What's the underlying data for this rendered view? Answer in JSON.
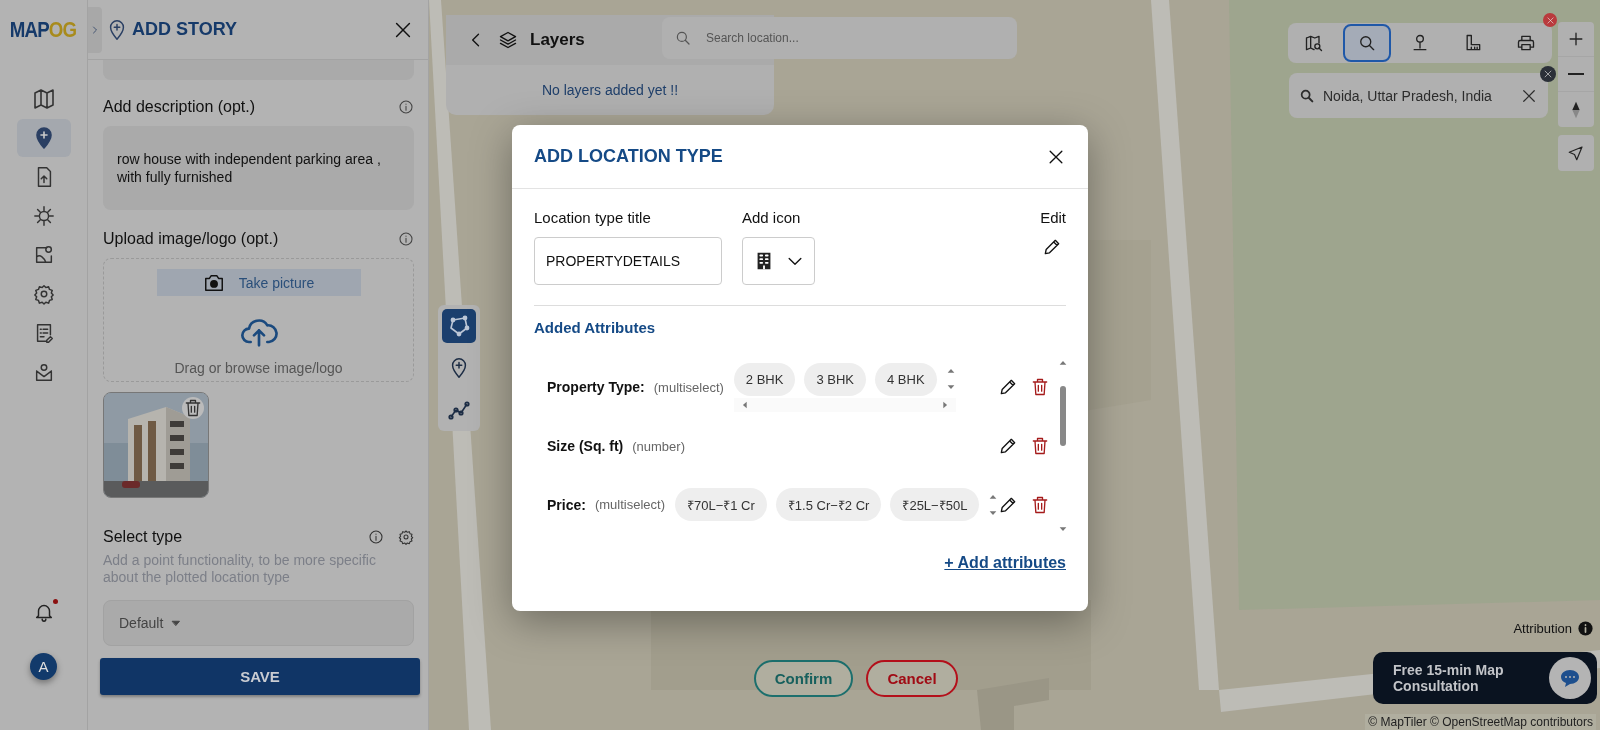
{
  "sidebar": {
    "logo": {
      "main": "MAP",
      "accent": "OG"
    },
    "items": [
      {
        "selected": false
      },
      {
        "selected": true
      },
      {
        "selected": false
      },
      {
        "selected": false
      },
      {
        "selected": false
      },
      {
        "selected": false
      },
      {
        "selected": false
      },
      {
        "selected": false
      }
    ],
    "notifications": {
      "unread": true
    },
    "avatar": "A"
  },
  "panel": {
    "title": "ADD STORY",
    "description": {
      "label": "Add description (opt.)",
      "value": "row house with independent parking area , with fully furnished"
    },
    "upload": {
      "label": "Upload image/logo (opt.)",
      "camera_button": "Take picture",
      "drop_hint": "Drag or browse image/logo"
    },
    "select_type": {
      "label": "Select type",
      "hint": "Add a point functionality, to be more specific about the plotted location type",
      "value": "Default"
    },
    "save": "SAVE"
  },
  "layers": {
    "title": "Layers",
    "empty_message": "No layers added yet !!"
  },
  "search": {
    "placeholder": "Search location..."
  },
  "draw_tools": [
    {
      "selected": true
    },
    {
      "selected": false
    },
    {
      "selected": false
    }
  ],
  "map_tools": {
    "items": [
      {
        "selected": false
      },
      {
        "selected": true
      },
      {
        "selected": false
      },
      {
        "selected": false
      },
      {
        "selected": false
      }
    ],
    "search_result": "Noida, Uttar Pradesh, India"
  },
  "modal": {
    "title": "ADD LOCATION TYPE",
    "title_field": {
      "label": "Location type title",
      "value": "PROPERTYDETAILS"
    },
    "icon_field": {
      "label": "Add icon"
    },
    "edit_label": "Edit",
    "attributes_heading": "Added Attributes",
    "attributes": [
      {
        "name": "Property Type:",
        "type": "(multiselect)",
        "options": [
          "2 BHK",
          "3 BHK",
          "4 BHK"
        ],
        "h_scroll": true
      },
      {
        "name": "Size (Sq. ft)",
        "type": "(number)"
      },
      {
        "name": "Price:",
        "type": "(multiselect)",
        "options": [
          "₹70L−₹1 Cr",
          "₹1.5 Cr−₹2 Cr",
          "₹25L−₹50L"
        ],
        "h_scroll": false
      }
    ],
    "add_link": "+ Add attributes"
  },
  "actions": {
    "confirm": "Confirm",
    "cancel": "Cancel"
  },
  "attribution": "Attribution",
  "consultation": "Free 15-min Map Consultation",
  "copyright": "© MapTiler © OpenStreetMap contributors"
}
